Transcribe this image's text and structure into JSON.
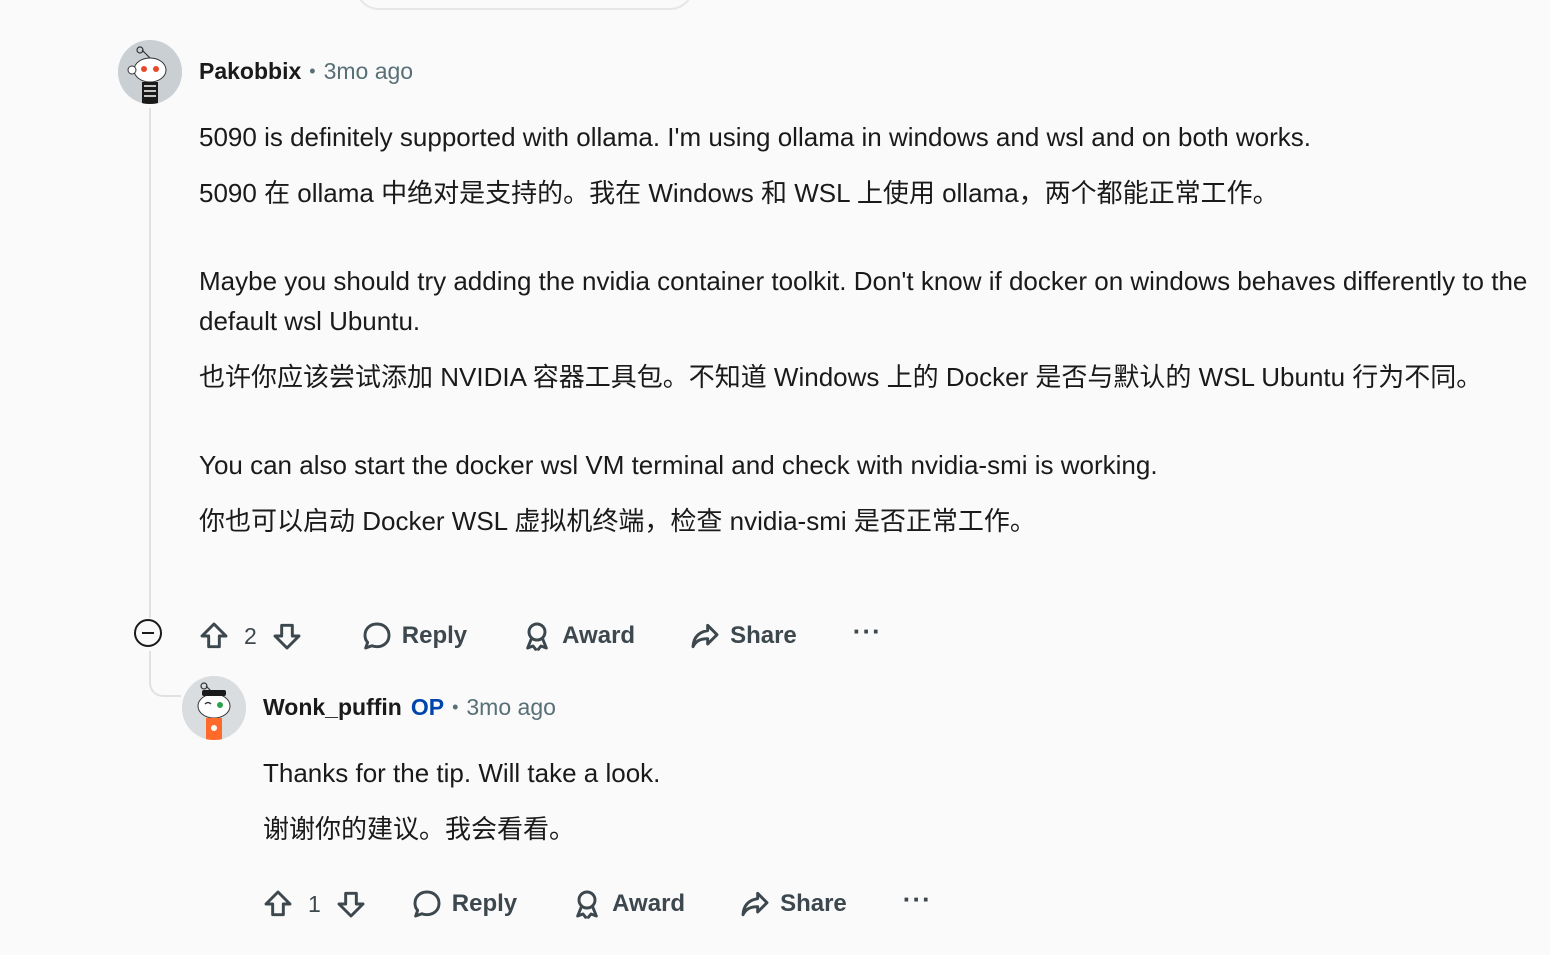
{
  "comment1": {
    "author": "Pakobbix",
    "time": "3mo ago",
    "paragraphs": [
      "5090 is definitely supported with ollama. I'm using ollama in windows and wsl and on both works.",
      "5090 在 ollama 中绝对是支持的。我在 Windows 和 WSL 上使用 ollama，两个都能正常工作。",
      "Maybe you should try adding the nvidia container toolkit. Don't know if docker on windows behaves differently to the default wsl Ubuntu.",
      "也许你应该尝试添加 NVIDIA 容器工具包。不知道 Windows 上的 Docker 是否与默认的 WSL Ubuntu 行为不同。",
      "You can also start the docker wsl VM terminal and check with nvidia-smi is working.",
      "你也可以启动 Docker WSL 虚拟机终端，检查 nvidia-smi 是否正常工作。"
    ],
    "votes": "2",
    "reply_label": "Reply",
    "award_label": "Award",
    "share_label": "Share",
    "more_label": "···"
  },
  "comment2": {
    "author": "Wonk_puffin",
    "op_badge": "OP",
    "time": "3mo ago",
    "paragraphs": [
      "Thanks for the tip. Will take a look.",
      "谢谢你的建议。我会看看。"
    ],
    "votes": "1",
    "reply_label": "Reply",
    "award_label": "Award",
    "share_label": "Share",
    "more_label": "···"
  },
  "separator": "•",
  "icons": {
    "upvote": "arrow-up-icon",
    "downvote": "arrow-down-icon",
    "reply": "speech-bubble-icon",
    "award": "award-ribbon-icon",
    "share": "share-arrow-icon",
    "collapse": "minus-circle-icon"
  }
}
